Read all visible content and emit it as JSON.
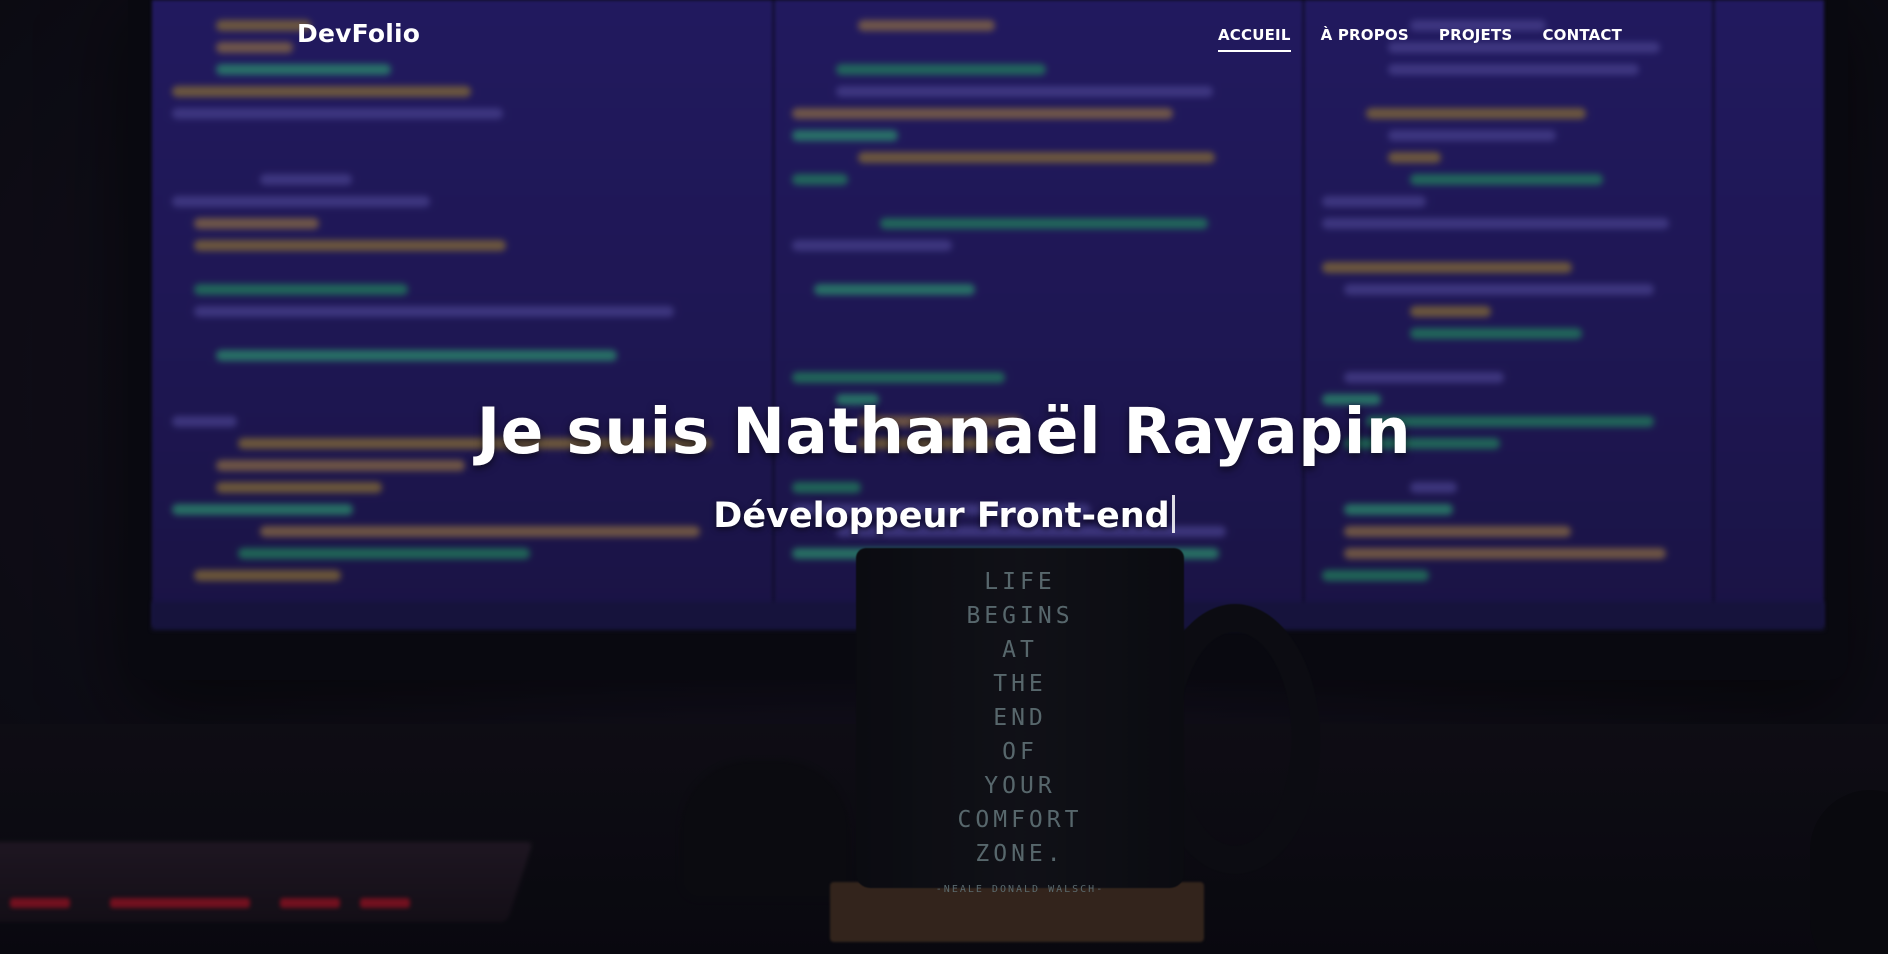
{
  "nav": {
    "brand": "DevFolio",
    "links": [
      {
        "label": "ACCUEIL",
        "active": true
      },
      {
        "label": "À PROPOS",
        "active": false
      },
      {
        "label": "PROJETS",
        "active": false
      },
      {
        "label": "CONTACT",
        "active": false
      }
    ]
  },
  "hero": {
    "title": "Je suis Nathanaël Rayapin",
    "subtitle": "Développeur Front-end"
  },
  "background": {
    "description_icons": [
      "monitor-image",
      "mug-image",
      "keyboard-image"
    ],
    "mug_quote": [
      "LIFE",
      "BEGINS",
      "AT",
      "THE",
      "END",
      "OF",
      "YOUR",
      "COMFORT",
      "ZONE."
    ],
    "mug_author": "-NEALE DONALD WALSCH-"
  },
  "colors": {
    "text": "#ffffff",
    "screen": "#2f238a",
    "code_green": "#2fbf86",
    "code_yellow": "#c9a24a"
  }
}
